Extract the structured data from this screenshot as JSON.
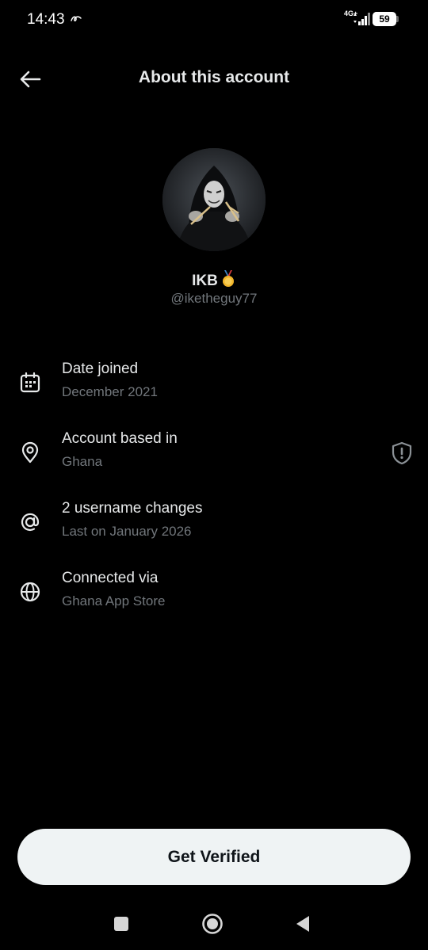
{
  "status_bar": {
    "time": "14:43",
    "network": "4G+",
    "battery_level": "59",
    "battery_fraction": 0.59
  },
  "header": {
    "title": "About this account",
    "back_icon": "arrow-left-icon"
  },
  "profile": {
    "name": "IKB",
    "badge_icon": "medal-icon",
    "handle": "@iketheguy77"
  },
  "info_items": [
    {
      "icon": "calendar-icon",
      "title": "Date joined",
      "subtitle": "December 2021"
    },
    {
      "icon": "location-pin-icon",
      "title": "Account based in",
      "subtitle": "Ghana",
      "trailing_icon": "shield-alert-icon"
    },
    {
      "icon": "at-sign-icon",
      "title": "2 username changes",
      "subtitle": "Last on January 2026"
    },
    {
      "icon": "globe-icon",
      "title": "Connected via",
      "subtitle": "Ghana App Store"
    }
  ],
  "cta": {
    "label": "Get Verified"
  },
  "nav_bar": {
    "recents_icon": "square-icon",
    "home_icon": "circle-home-icon",
    "back_icon": "triangle-back-icon"
  },
  "colors": {
    "background": "#000000",
    "primary_text": "#e7e9ea",
    "secondary_text": "#71767b",
    "button_bg": "#eff3f4",
    "button_text": "#0f1419"
  }
}
